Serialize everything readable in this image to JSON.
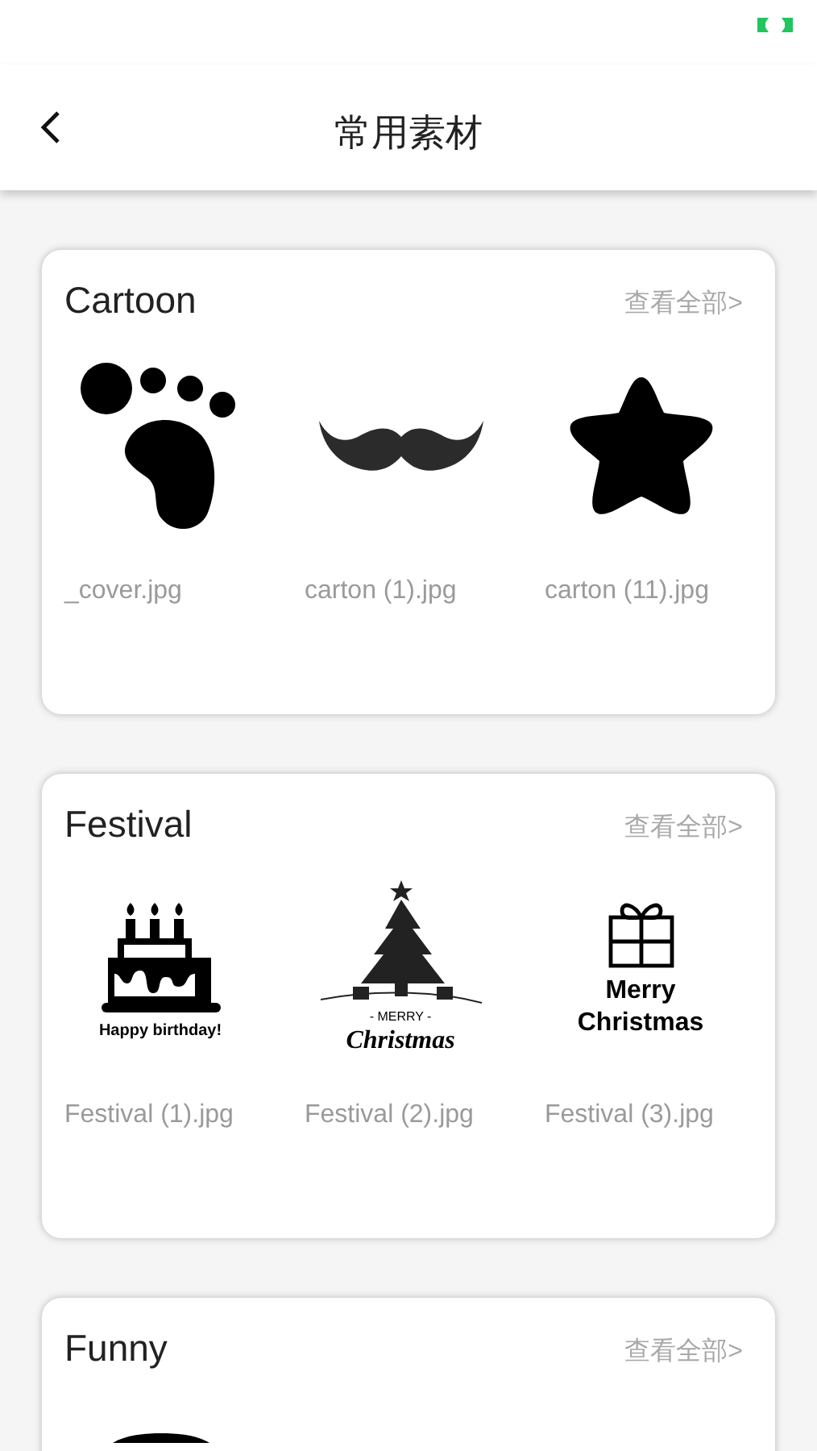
{
  "header": {
    "title": "常用素材"
  },
  "sections": [
    {
      "title": "Cartoon",
      "more": "查看全部>",
      "items": [
        {
          "kind": "footprint",
          "caption": "_cover.jpg"
        },
        {
          "kind": "mustache",
          "caption": "carton (1).jpg"
        },
        {
          "kind": "star",
          "caption": "carton (11).jpg"
        }
      ]
    },
    {
      "title": "Festival",
      "more": "查看全部>",
      "items": [
        {
          "kind": "cake",
          "art_text": [
            "Happy birthday!"
          ],
          "caption": "Festival (1).jpg"
        },
        {
          "kind": "tree",
          "art_text": [
            "- MERRY -",
            "Christmas"
          ],
          "caption": "Festival (2).jpg"
        },
        {
          "kind": "gift",
          "art_text": [
            "Merry",
            "Christmas"
          ],
          "caption": "Festival (3).jpg"
        }
      ]
    },
    {
      "title": "Funny",
      "more": "查看全部>",
      "items": [
        {
          "kind": "round"
        }
      ]
    }
  ]
}
